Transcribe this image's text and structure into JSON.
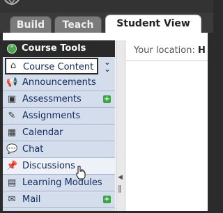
{
  "tabs": {
    "build": "Build",
    "teach": "Teach",
    "student_view": "Student View"
  },
  "course_tools": {
    "title": "Course Tools",
    "items": [
      {
        "label": "Course Content",
        "icon": "house-icon",
        "selected": true
      },
      {
        "label": "Announcements",
        "icon": "megaphone-icon"
      },
      {
        "label": "Assessments",
        "icon": "assessment-icon",
        "add": true
      },
      {
        "label": "Assignments",
        "icon": "assignment-icon"
      },
      {
        "label": "Calendar",
        "icon": "calendar-icon"
      },
      {
        "label": "Chat",
        "icon": "chat-bubble-icon"
      },
      {
        "label": "Discussions",
        "icon": "pin-icon",
        "hover": true
      },
      {
        "label": "Learning Modules",
        "icon": "module-icon"
      },
      {
        "label": "Mail",
        "icon": "mail-icon",
        "add": true
      }
    ]
  },
  "breadcrumb": {
    "prefix": "Your location:",
    "value": "H"
  },
  "colors": {
    "header": "#2a2a2a",
    "panel": "#d3ddeb",
    "link": "#0f2a5e",
    "add": "#3aa640"
  }
}
